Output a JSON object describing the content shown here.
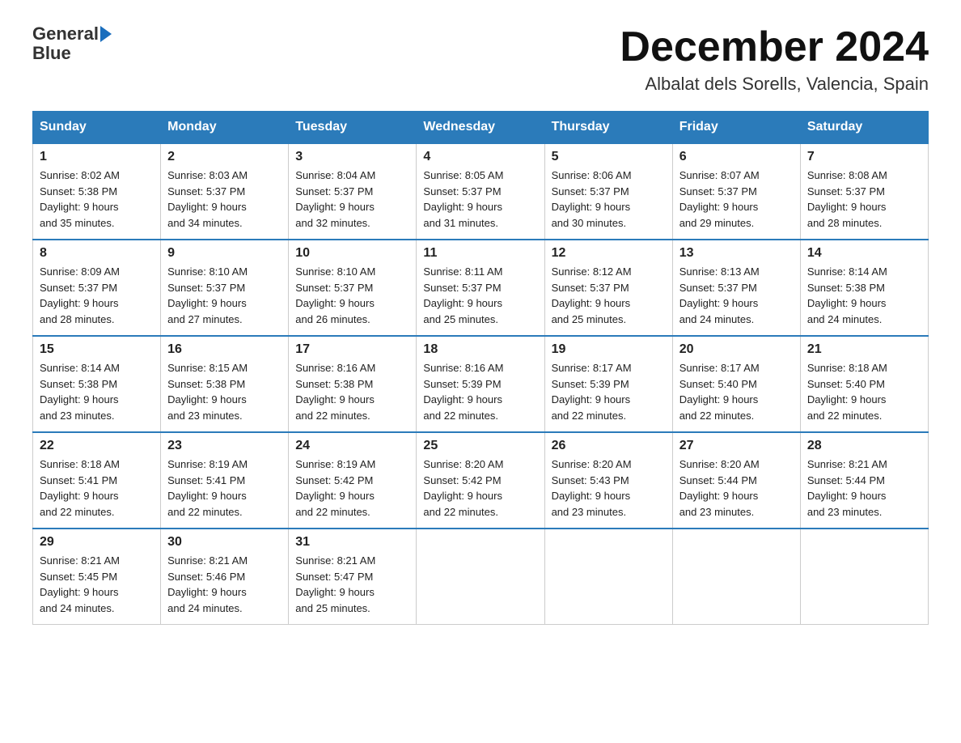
{
  "header": {
    "logo_text_general": "General",
    "logo_text_blue": "Blue",
    "month_title": "December 2024",
    "location": "Albalat dels Sorells, Valencia, Spain"
  },
  "days_of_week": [
    "Sunday",
    "Monday",
    "Tuesday",
    "Wednesday",
    "Thursday",
    "Friday",
    "Saturday"
  ],
  "weeks": [
    [
      {
        "day": "1",
        "sunrise": "8:02 AM",
        "sunset": "5:38 PM",
        "daylight": "9 hours and 35 minutes."
      },
      {
        "day": "2",
        "sunrise": "8:03 AM",
        "sunset": "5:37 PM",
        "daylight": "9 hours and 34 minutes."
      },
      {
        "day": "3",
        "sunrise": "8:04 AM",
        "sunset": "5:37 PM",
        "daylight": "9 hours and 32 minutes."
      },
      {
        "day": "4",
        "sunrise": "8:05 AM",
        "sunset": "5:37 PM",
        "daylight": "9 hours and 31 minutes."
      },
      {
        "day": "5",
        "sunrise": "8:06 AM",
        "sunset": "5:37 PM",
        "daylight": "9 hours and 30 minutes."
      },
      {
        "day": "6",
        "sunrise": "8:07 AM",
        "sunset": "5:37 PM",
        "daylight": "9 hours and 29 minutes."
      },
      {
        "day": "7",
        "sunrise": "8:08 AM",
        "sunset": "5:37 PM",
        "daylight": "9 hours and 28 minutes."
      }
    ],
    [
      {
        "day": "8",
        "sunrise": "8:09 AM",
        "sunset": "5:37 PM",
        "daylight": "9 hours and 28 minutes."
      },
      {
        "day": "9",
        "sunrise": "8:10 AM",
        "sunset": "5:37 PM",
        "daylight": "9 hours and 27 minutes."
      },
      {
        "day": "10",
        "sunrise": "8:10 AM",
        "sunset": "5:37 PM",
        "daylight": "9 hours and 26 minutes."
      },
      {
        "day": "11",
        "sunrise": "8:11 AM",
        "sunset": "5:37 PM",
        "daylight": "9 hours and 25 minutes."
      },
      {
        "day": "12",
        "sunrise": "8:12 AM",
        "sunset": "5:37 PM",
        "daylight": "9 hours and 25 minutes."
      },
      {
        "day": "13",
        "sunrise": "8:13 AM",
        "sunset": "5:37 PM",
        "daylight": "9 hours and 24 minutes."
      },
      {
        "day": "14",
        "sunrise": "8:14 AM",
        "sunset": "5:38 PM",
        "daylight": "9 hours and 24 minutes."
      }
    ],
    [
      {
        "day": "15",
        "sunrise": "8:14 AM",
        "sunset": "5:38 PM",
        "daylight": "9 hours and 23 minutes."
      },
      {
        "day": "16",
        "sunrise": "8:15 AM",
        "sunset": "5:38 PM",
        "daylight": "9 hours and 23 minutes."
      },
      {
        "day": "17",
        "sunrise": "8:16 AM",
        "sunset": "5:38 PM",
        "daylight": "9 hours and 22 minutes."
      },
      {
        "day": "18",
        "sunrise": "8:16 AM",
        "sunset": "5:39 PM",
        "daylight": "9 hours and 22 minutes."
      },
      {
        "day": "19",
        "sunrise": "8:17 AM",
        "sunset": "5:39 PM",
        "daylight": "9 hours and 22 minutes."
      },
      {
        "day": "20",
        "sunrise": "8:17 AM",
        "sunset": "5:40 PM",
        "daylight": "9 hours and 22 minutes."
      },
      {
        "day": "21",
        "sunrise": "8:18 AM",
        "sunset": "5:40 PM",
        "daylight": "9 hours and 22 minutes."
      }
    ],
    [
      {
        "day": "22",
        "sunrise": "8:18 AM",
        "sunset": "5:41 PM",
        "daylight": "9 hours and 22 minutes."
      },
      {
        "day": "23",
        "sunrise": "8:19 AM",
        "sunset": "5:41 PM",
        "daylight": "9 hours and 22 minutes."
      },
      {
        "day": "24",
        "sunrise": "8:19 AM",
        "sunset": "5:42 PM",
        "daylight": "9 hours and 22 minutes."
      },
      {
        "day": "25",
        "sunrise": "8:20 AM",
        "sunset": "5:42 PM",
        "daylight": "9 hours and 22 minutes."
      },
      {
        "day": "26",
        "sunrise": "8:20 AM",
        "sunset": "5:43 PM",
        "daylight": "9 hours and 23 minutes."
      },
      {
        "day": "27",
        "sunrise": "8:20 AM",
        "sunset": "5:44 PM",
        "daylight": "9 hours and 23 minutes."
      },
      {
        "day": "28",
        "sunrise": "8:21 AM",
        "sunset": "5:44 PM",
        "daylight": "9 hours and 23 minutes."
      }
    ],
    [
      {
        "day": "29",
        "sunrise": "8:21 AM",
        "sunset": "5:45 PM",
        "daylight": "9 hours and 24 minutes."
      },
      {
        "day": "30",
        "sunrise": "8:21 AM",
        "sunset": "5:46 PM",
        "daylight": "9 hours and 24 minutes."
      },
      {
        "day": "31",
        "sunrise": "8:21 AM",
        "sunset": "5:47 PM",
        "daylight": "9 hours and 25 minutes."
      },
      null,
      null,
      null,
      null
    ]
  ],
  "labels": {
    "sunrise": "Sunrise:",
    "sunset": "Sunset:",
    "daylight": "Daylight:"
  }
}
